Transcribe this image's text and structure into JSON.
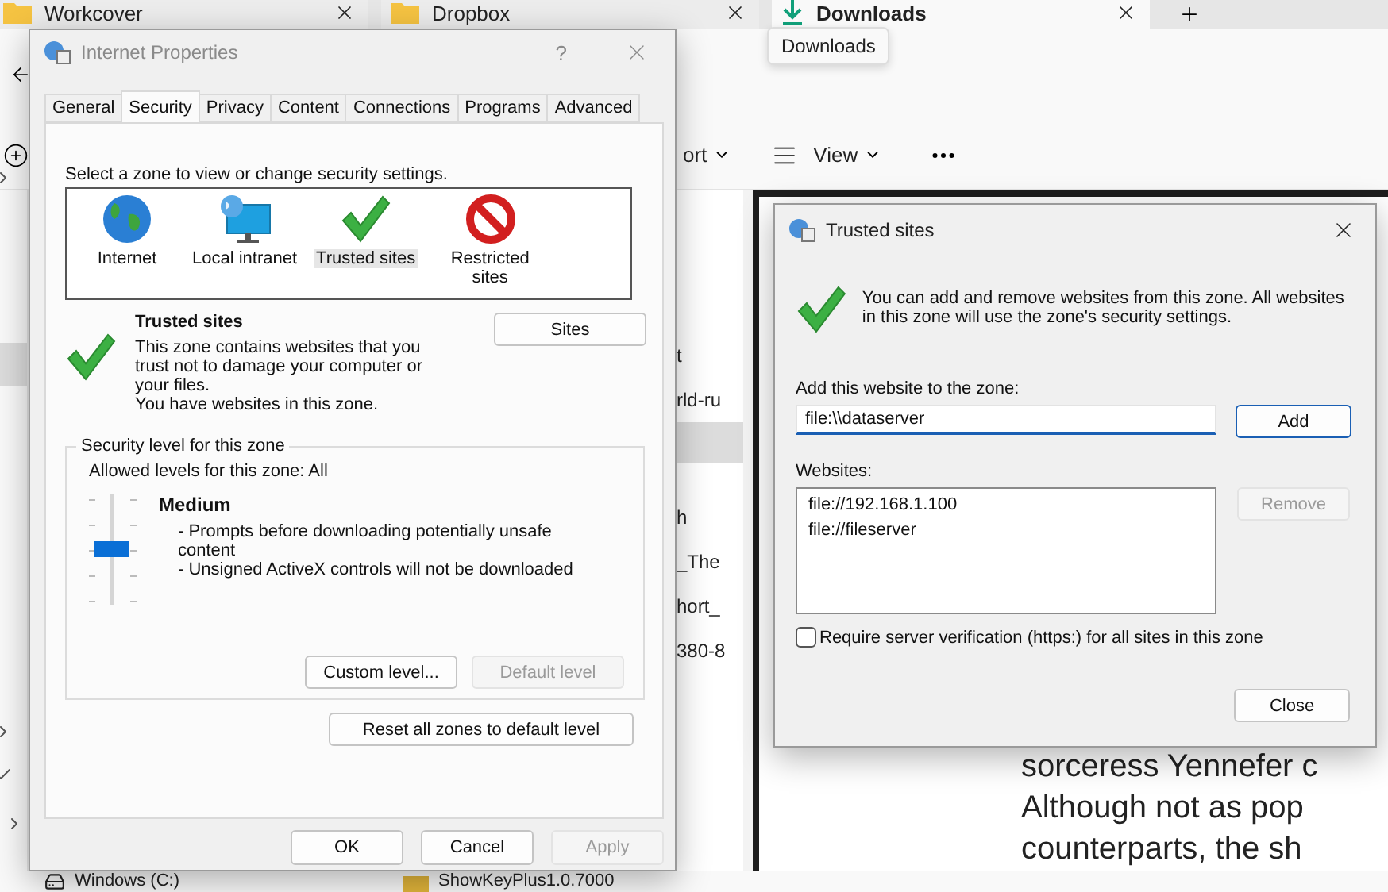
{
  "explorer": {
    "tabs": [
      {
        "label": "Workcover",
        "kind": "folder",
        "selected": false
      },
      {
        "label": "Dropbox",
        "kind": "folder",
        "selected": false
      },
      {
        "label": "Downloads",
        "kind": "download",
        "selected": true
      }
    ],
    "tooltip": "Downloads",
    "command_bar": {
      "sort_label": "ort",
      "view_label": "View"
    },
    "file_names": [
      "t",
      "rld-ru",
      "h",
      "_The",
      "hort_",
      "380-8"
    ],
    "bottom_items": [
      {
        "label": "Windows (C:)",
        "kind": "drive"
      },
      {
        "label": "ShowKeyPlus1.0.7000",
        "kind": "archive"
      }
    ],
    "preview": {
      "lines": [
        "sorceress Yennefer c",
        "Although not as pop",
        "counterparts, the sh"
      ]
    }
  },
  "internet_properties": {
    "title": "Internet Properties",
    "help": "?",
    "tabs": [
      {
        "label": "General",
        "selected": false
      },
      {
        "label": "Security",
        "selected": true
      },
      {
        "label": "Privacy",
        "selected": false
      },
      {
        "label": "Content",
        "selected": false
      },
      {
        "label": "Connections",
        "selected": false
      },
      {
        "label": "Programs",
        "selected": false
      },
      {
        "label": "Advanced",
        "selected": false
      }
    ],
    "zone_prompt": "Select a zone to view or change security settings.",
    "zones": [
      {
        "label": "Internet",
        "kind": "globe",
        "selected": false
      },
      {
        "label": "Local intranet",
        "kind": "intranet",
        "selected": false
      },
      {
        "label": "Trusted sites",
        "kind": "trusted",
        "selected": true
      },
      {
        "label": "Restricted sites",
        "kind": "restricted",
        "selected": false
      }
    ],
    "zone_title": "Trusted sites",
    "zone_description": "This zone contains websites that you trust not to damage your computer or your files.",
    "zone_status": "You have websites in this zone.",
    "sites_button": "Sites",
    "security_level": {
      "legend": "Security level for this zone",
      "allowed": "Allowed levels for this zone: All",
      "level": 0.5,
      "name": "Medium",
      "bullets": [
        "- Prompts before downloading potentially unsafe content",
        "- Unsigned ActiveX controls will not be downloaded"
      ],
      "custom_button": {
        "label": "Custom level...",
        "disabled": false
      },
      "default_button": {
        "label": "Default level",
        "disabled": true
      }
    },
    "reset_button": "Reset all zones to default level",
    "buttons": [
      {
        "label": "OK",
        "disabled": false
      },
      {
        "label": "Cancel",
        "disabled": false
      },
      {
        "label": "Apply",
        "disabled": true
      }
    ]
  },
  "trusted_sites": {
    "title": "Trusted sites",
    "info": "You can add and remove websites from this zone. All websites in this zone will use the zone's security settings.",
    "add_label": "Add this website to the zone:",
    "add_value": "file:\\\\dataserver",
    "add_button": "Add",
    "websites_label": "Websites:",
    "websites": [
      "file://192.168.1.100",
      "file://fileserver"
    ],
    "remove_button": {
      "label": "Remove",
      "disabled": true
    },
    "require_https": {
      "label": "Require server verification (https:) for all sites in this zone",
      "checked": false
    },
    "close_button": "Close"
  }
}
